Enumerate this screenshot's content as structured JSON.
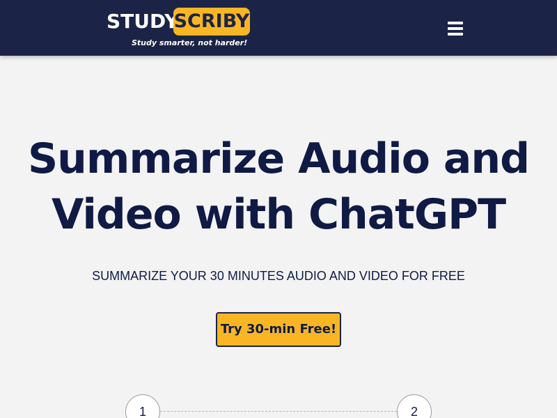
{
  "header": {
    "logo": {
      "word1": "STUDY",
      "word2": "SCRIBY",
      "tagline": "Study smarter, not harder!"
    },
    "menu_icon": "hamburger-menu-icon"
  },
  "hero": {
    "title_line1": "Summarize Audio and",
    "title_line2": "Video with ChatGPT",
    "subtitle": "SUMMARIZE YOUR 30 MINUTES AUDIO AND VIDEO FOR FREE",
    "cta_label": "Try 30-min Free!"
  },
  "steps": [
    "1",
    "2"
  ],
  "colors": {
    "header_bg": "#1b2446",
    "accent": "#f9b624",
    "text_dark": "#0f1a45",
    "page_bg": "#f3f3f3"
  }
}
